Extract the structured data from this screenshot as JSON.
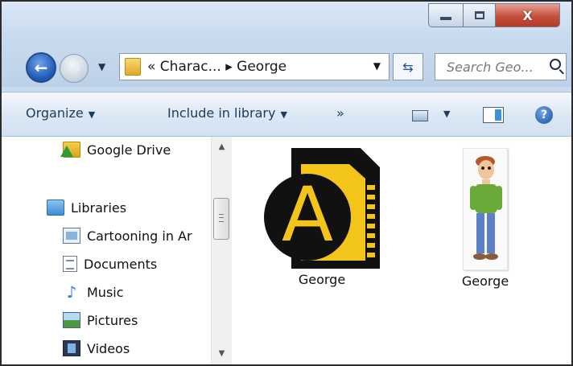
{
  "window": {
    "min_label": "",
    "close_glyph": "X"
  },
  "nav": {
    "back_glyph": "←",
    "forward_glyph": "→",
    "address_text": "« Charac... ▸ George",
    "search_placeholder": "Search Geo..."
  },
  "toolbar": {
    "organize_label": "Organize",
    "include_label": "Include in library",
    "more_label": "»",
    "help_glyph": "?"
  },
  "sidebar": {
    "items": [
      {
        "label": "Google Drive",
        "icon": "google-drive-icon"
      },
      {
        "label": "Libraries",
        "icon": "libraries-icon"
      },
      {
        "label": "Cartooning in Ar",
        "icon": "library-folder-icon"
      },
      {
        "label": "Documents",
        "icon": "documents-icon"
      },
      {
        "label": "Music",
        "icon": "music-icon"
      },
      {
        "label": "Pictures",
        "icon": "pictures-icon"
      },
      {
        "label": "Videos",
        "icon": "videos-icon"
      }
    ]
  },
  "files": [
    {
      "name": "George",
      "type": "animation-file",
      "thumb_letter": "A"
    },
    {
      "name": "George",
      "type": "character-image"
    }
  ],
  "colors": {
    "accent_yellow": "#f3c51a",
    "frame_blue": "#c9dcef",
    "close_red": "#c4503d"
  }
}
